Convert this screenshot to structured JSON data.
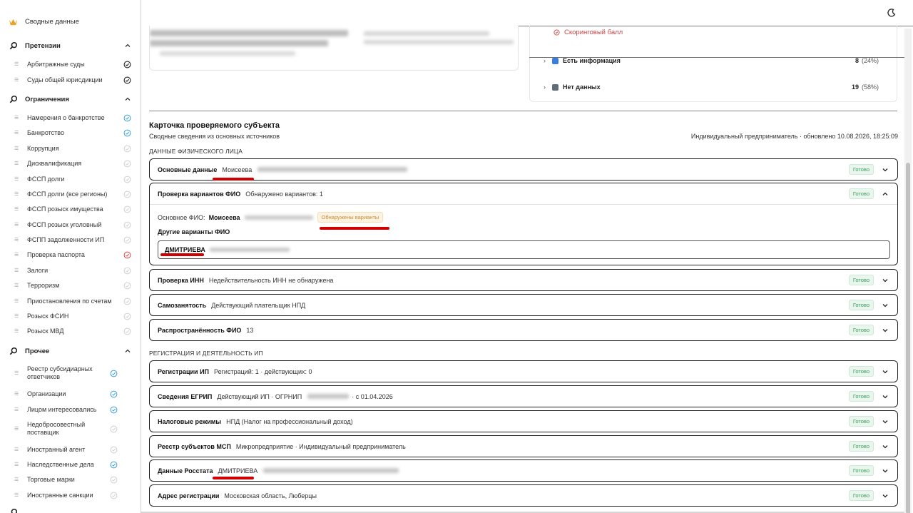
{
  "sidebar": {
    "brand": "Сводные данные",
    "sections": [
      {
        "title": "Претензии",
        "items": [
          {
            "label": "Арбитражные суды",
            "status": "done"
          },
          {
            "label": "Суды общей юрисдикции",
            "status": "done"
          }
        ]
      },
      {
        "title": "Ограничения",
        "items": [
          {
            "label": "Намерения о банкротстве",
            "status": "ok"
          },
          {
            "label": "Банкротство",
            "status": "ok"
          },
          {
            "label": "Коррупция",
            "status": "neutral"
          },
          {
            "label": "Дисквалификация",
            "status": "neutral"
          },
          {
            "label": "ФССП долги",
            "status": "neutral"
          },
          {
            "label": "ФССП долги (все регионы)",
            "status": "neutral"
          },
          {
            "label": "ФССП розыск имущества",
            "status": "neutral"
          },
          {
            "label": "ФССП розыск уголовный",
            "status": "neutral"
          },
          {
            "label": "ФСПП задолженности ИП",
            "status": "neutral"
          },
          {
            "label": "Проверка паспорта",
            "status": "error"
          },
          {
            "label": "Залоги",
            "status": "neutral"
          },
          {
            "label": "Терроризм",
            "status": "neutral"
          },
          {
            "label": "Приостановления по счетам",
            "status": "neutral"
          },
          {
            "label": "Розыск ФСИН",
            "status": "neutral"
          },
          {
            "label": "Розыск МВД",
            "status": "neutral"
          }
        ]
      },
      {
        "title": "Прочее",
        "items": [
          {
            "label": "Реестр субсидиарных ответчиков",
            "status": "ok"
          },
          {
            "label": "Организации",
            "status": "ok"
          },
          {
            "label": "Лицом интересовались",
            "status": "ok"
          },
          {
            "label": "Недобросовестный поставщик",
            "status": "neutral"
          },
          {
            "label": "Иностранный агент",
            "status": "neutral"
          },
          {
            "label": "Наследственные дела",
            "status": "ok"
          },
          {
            "label": "Торговые марки",
            "status": "neutral"
          },
          {
            "label": "Иностранные санкции",
            "status": "neutral"
          }
        ]
      }
    ]
  },
  "summary": {
    "score_label": "Скоринговый балл",
    "stats": [
      {
        "label": "Есть информация",
        "count": "8",
        "pct": "(24%)",
        "color": "#3b7ddd"
      },
      {
        "label": "Нет данных",
        "count": "19",
        "pct": "(58%)",
        "color": "#5f6b7a"
      }
    ]
  },
  "card": {
    "title": "Карточка проверяемого субъекта",
    "subtitle": "Сводные сведения из основных источников",
    "meta": "Индивидуальный предприниматель · обновлено 10.08.2026, 18:25:09",
    "section1": "ДАННЫЕ ФИЗИЧЕСКОГО ЛИЦА",
    "section2": "РЕГИСТРАЦИЯ И ДЕЯТЕЛЬНОСТЬ ИП",
    "ready": "Готово",
    "basic": {
      "label": "Основные данные",
      "value": "Моисеева"
    },
    "fio_check": {
      "label": "Проверка вариантов ФИО",
      "value": "Обнаружено вариантов: 1",
      "main_label": "Основное ФИО:",
      "main_value": "Моисеева",
      "warn": "Обнаружены варианты",
      "other_label": "Другие варианты ФИО",
      "variant": "ДМИТРИЕВА"
    },
    "inn": {
      "label": "Проверка ИНН",
      "value": "Недействительность ИНН не обнаружена"
    },
    "self": {
      "label": "Самозанятость",
      "value": "Действующий плательщик НПД"
    },
    "spread": {
      "label": "Распространённость ФИО",
      "value": "13"
    },
    "reg": {
      "label": "Регистрации ИП",
      "value": "Регистраций: 1 · действующих: 0"
    },
    "egrip": {
      "label": "Сведения ЕГРИП",
      "value": "Действующий ИП · ОГРНИП",
      "value2": "· с 01.04.2026"
    },
    "tax": {
      "label": "Налоговые режимы",
      "value": "НПД (Налог на профессиональный доход)"
    },
    "msp": {
      "label": "Реестр субъектов МСП",
      "value": "Микропредприятие · Индивидуальный предприниматель"
    },
    "rosstat": {
      "label": "Данные Росстата",
      "value": "ДМИТРИЕВА"
    },
    "address": {
      "label": "Адрес регистрации",
      "value": "Московская область, Люберцы"
    }
  }
}
